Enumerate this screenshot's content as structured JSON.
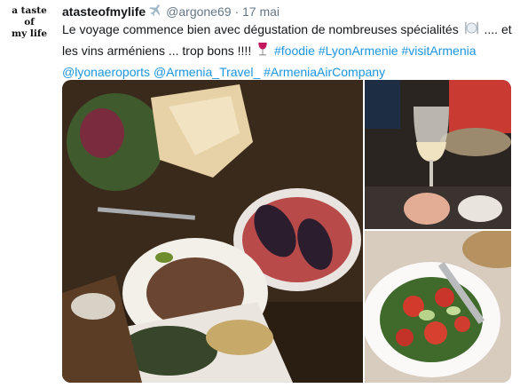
{
  "avatar": {
    "lines": [
      "a taste",
      "of",
      "my life"
    ]
  },
  "tweet": {
    "display_name": "atasteofmylife",
    "handle": "@argone69",
    "separator": "·",
    "time": "17 mai",
    "text_part1": "Le voyage commence bien avec dégustation de nombreuses spécialités",
    "text_part2": ".... et les vins arméniens ... trop bons !!!!",
    "hashtags": [
      "#foodie",
      "#LyonArmenie",
      "#visitArmenia"
    ],
    "mentions": [
      "@lyonaeroports",
      "@Armenia_Travel_"
    ],
    "last_hashtag": "#ArmeniaAirCompany"
  },
  "icons": {
    "name_badge": "airplane-icon",
    "emoji_1": "fork-knife-plate-icon",
    "emoji_2": "wine-glass-icon"
  },
  "colors": {
    "link": "#1b95e0",
    "meta": "#657786",
    "text": "#14171a"
  }
}
